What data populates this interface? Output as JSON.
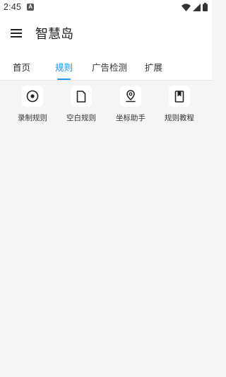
{
  "status_bar": {
    "time": "2:45",
    "notification_badge": "A",
    "icons": [
      "wifi-icon",
      "signal-icon",
      "battery-icon"
    ]
  },
  "app_bar": {
    "menu_icon": "hamburger-menu-icon",
    "title": "智慧岛"
  },
  "tabs": [
    {
      "label": "首页",
      "active": false
    },
    {
      "label": "规则",
      "active": true
    },
    {
      "label": "广告检测",
      "active": false
    },
    {
      "label": "扩展",
      "active": false
    }
  ],
  "rule_actions": [
    {
      "label": "录制规则",
      "icon": "record-icon"
    },
    {
      "label": "空白规则",
      "icon": "blank-file-icon"
    },
    {
      "label": "坐标助手",
      "icon": "location-pin-icon"
    },
    {
      "label": "规则教程",
      "icon": "bookmark-book-icon"
    }
  ],
  "colors": {
    "accent": "#2196f3",
    "background": "#f5f5f5",
    "surface": "#ffffff"
  }
}
